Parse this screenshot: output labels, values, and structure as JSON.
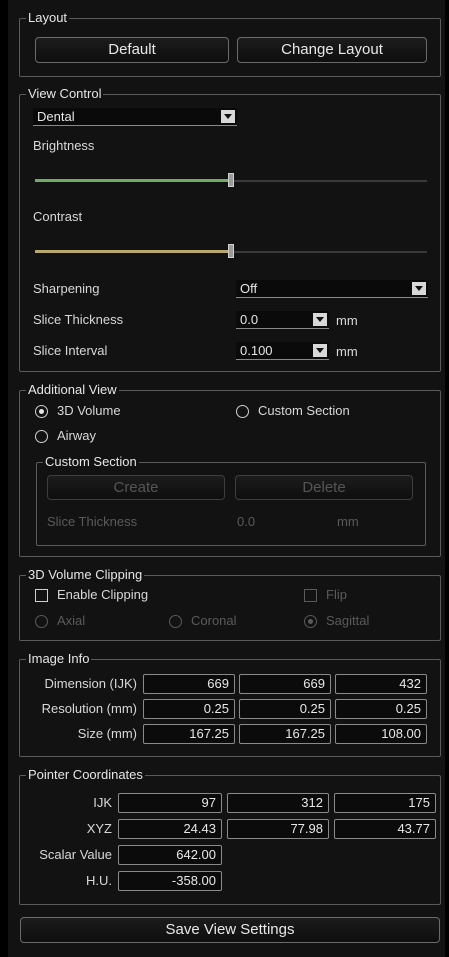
{
  "layout": {
    "title": "Layout",
    "default_label": "Default",
    "change_label": "Change Layout"
  },
  "view_control": {
    "title": "View Control",
    "preset": "Dental",
    "brightness_label": "Brightness",
    "brightness_value": 0.5,
    "contrast_label": "Contrast",
    "contrast_value": 0.5,
    "sharpening_label": "Sharpening",
    "sharpening_value": "Off",
    "slice_thickness_label": "Slice Thickness",
    "slice_thickness_value": "0.0",
    "slice_thickness_unit": "mm",
    "slice_interval_label": "Slice Interval",
    "slice_interval_value": "0.100",
    "slice_interval_unit": "mm"
  },
  "additional_view": {
    "title": "Additional View",
    "opt_3d": "3D Volume",
    "opt_custom": "Custom Section",
    "opt_airway": "Airway",
    "selected": "3D Volume",
    "custom_section": {
      "title": "Custom Section",
      "create_label": "Create",
      "delete_label": "Delete",
      "thickness_label": "Slice Thickness",
      "thickness_value": "0.0",
      "thickness_unit": "mm"
    }
  },
  "clipping": {
    "title": "3D Volume Clipping",
    "enable_label": "Enable Clipping",
    "flip_label": "Flip",
    "axial_label": "Axial",
    "coronal_label": "Coronal",
    "sagittal_label": "Sagittal",
    "selected": "Sagittal"
  },
  "image_info": {
    "title": "Image Info",
    "rows": [
      {
        "label": "Dimension (IJK)",
        "values": [
          "669",
          "669",
          "432"
        ]
      },
      {
        "label": "Resolution (mm)",
        "values": [
          "0.25",
          "0.25",
          "0.25"
        ]
      },
      {
        "label": "Size (mm)",
        "values": [
          "167.25",
          "167.25",
          "108.00"
        ]
      }
    ]
  },
  "pointer": {
    "title": "Pointer Coordinates",
    "ijk_label": "IJK",
    "ijk": [
      "97",
      "312",
      "175"
    ],
    "xyz_label": "XYZ",
    "xyz": [
      "24.43",
      "77.98",
      "43.77"
    ],
    "scalar_label": "Scalar Value",
    "scalar_value": "642.00",
    "hu_label": "H.U.",
    "hu_value": "-358.00"
  },
  "save_label": "Save View Settings",
  "colors": {
    "brightness_fill": "#6fae62",
    "contrast_fill": "#b8a86a"
  }
}
